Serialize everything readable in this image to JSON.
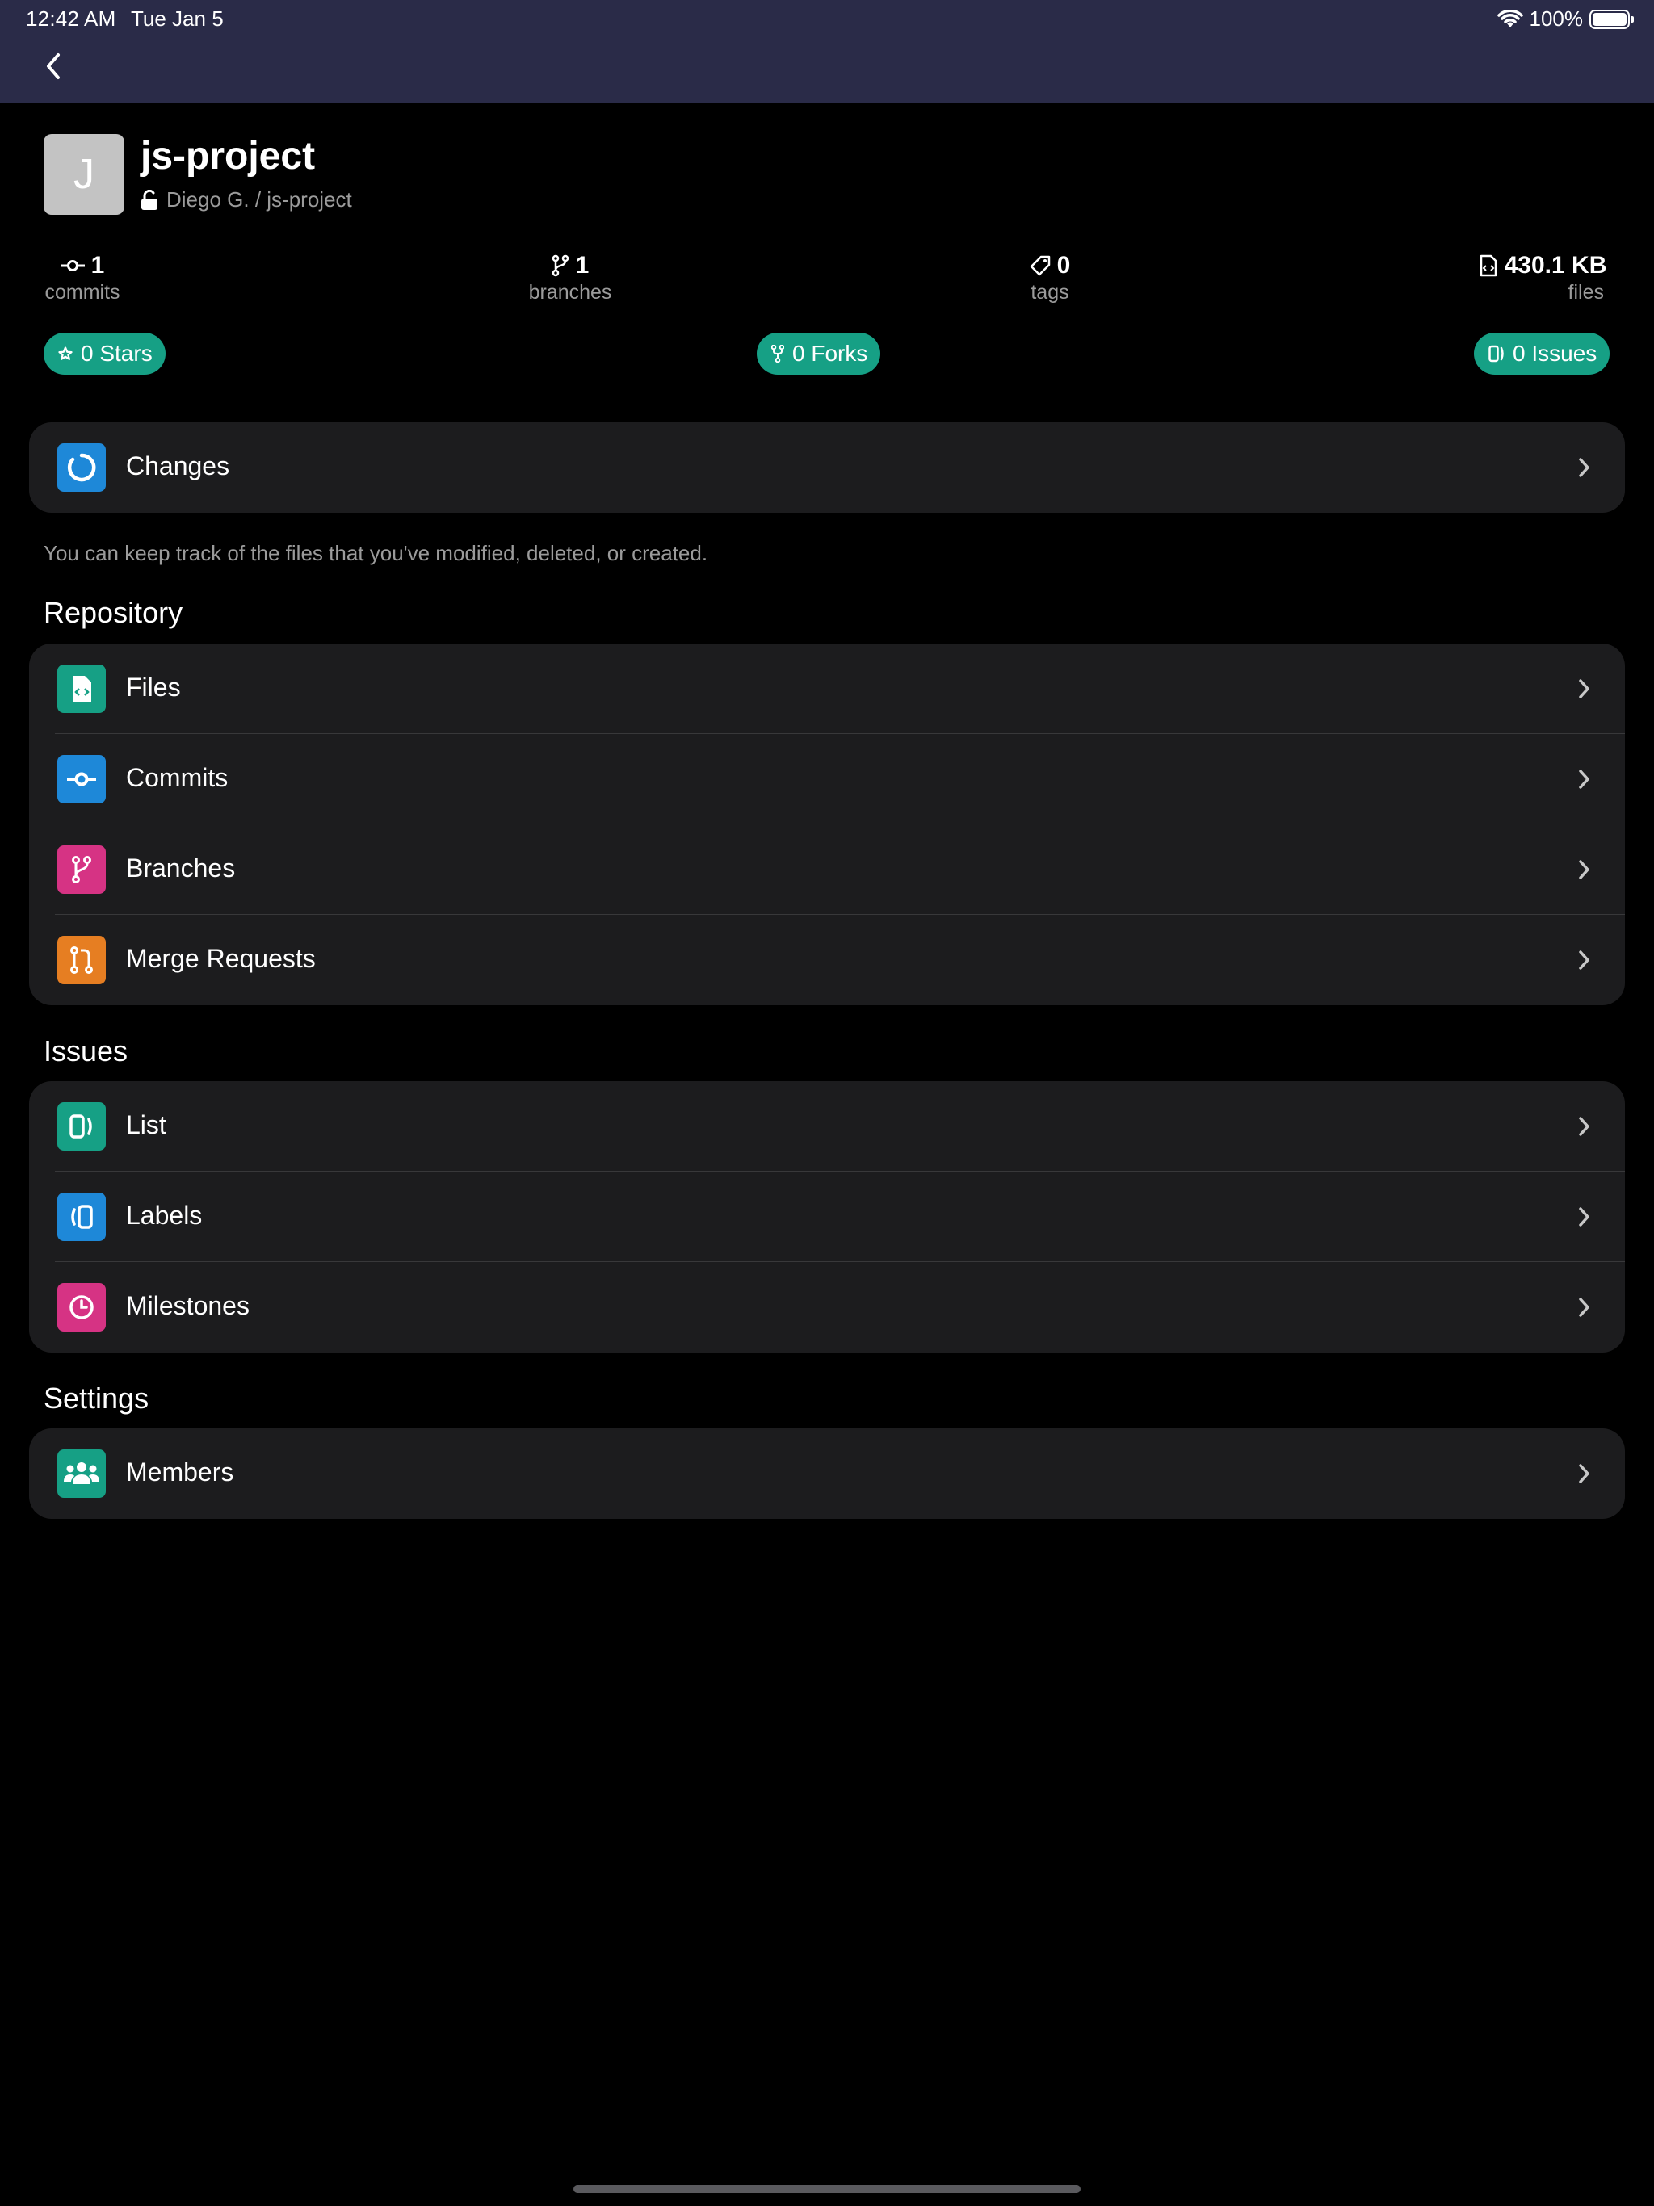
{
  "status_bar": {
    "time": "12:42 AM",
    "date": "Tue Jan 5",
    "battery": "100%"
  },
  "header": {
    "avatar_letter": "J",
    "title": "js-project",
    "path": "Diego G. / js-project"
  },
  "stats": [
    {
      "value": "1",
      "label": "commits"
    },
    {
      "value": "1",
      "label": "branches"
    },
    {
      "value": "0",
      "label": "tags"
    },
    {
      "value": "430.1 KB",
      "label": "files"
    }
  ],
  "pills": {
    "stars": "0 Stars",
    "forks": "0 Forks",
    "issues": "0 Issues"
  },
  "changes": {
    "label": "Changes",
    "footnote": "You can keep track of the files that you've modified, deleted, or created."
  },
  "sections": {
    "repository": {
      "title": "Repository",
      "items": [
        {
          "label": "Files",
          "color": "#16a085"
        },
        {
          "label": "Commits",
          "color": "#1e88d8"
        },
        {
          "label": "Branches",
          "color": "#d63384"
        },
        {
          "label": "Merge Requests",
          "color": "#e67e22"
        }
      ]
    },
    "issues": {
      "title": "Issues",
      "items": [
        {
          "label": "List",
          "color": "#16a085"
        },
        {
          "label": "Labels",
          "color": "#1e88d8"
        },
        {
          "label": "Milestones",
          "color": "#d63384"
        }
      ]
    },
    "settings": {
      "title": "Settings",
      "items": [
        {
          "label": "Members",
          "color": "#16a085"
        }
      ]
    }
  },
  "colors": {
    "nav_bg": "#2a2b48",
    "accent": "#16a085",
    "card_bg": "#1c1c1e"
  }
}
